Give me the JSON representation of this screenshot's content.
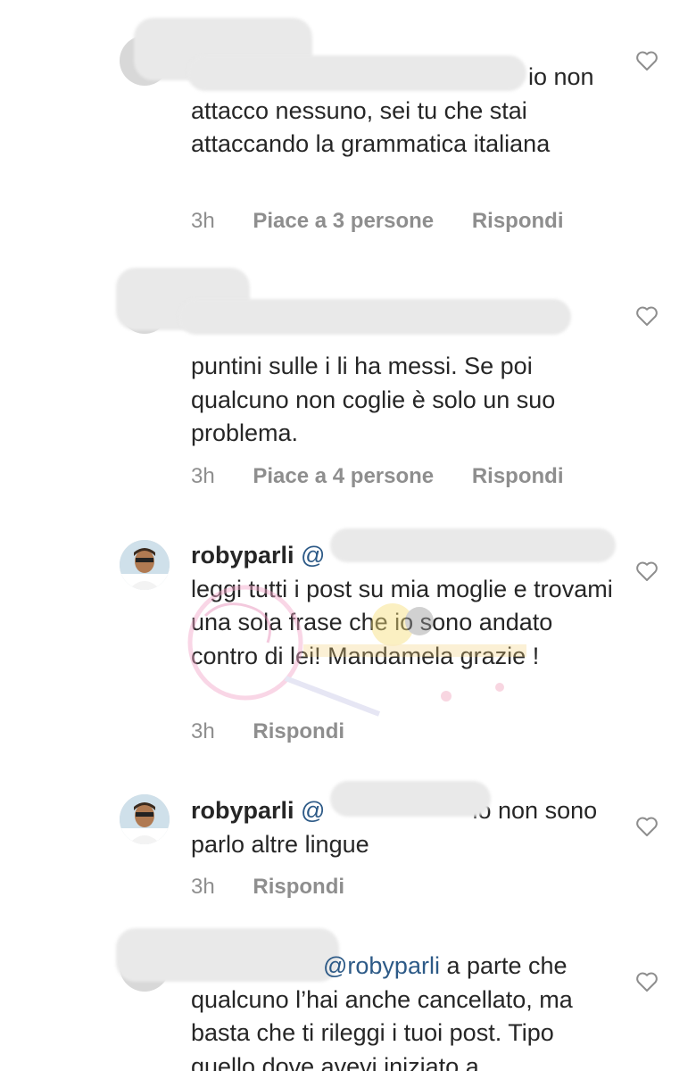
{
  "comments": [
    {
      "username": "",
      "mention": "",
      "text": "io non attacco nessuno, sei tu che stai attaccando la grammatica italiana",
      "time": "3h",
      "likes": "Piace a 3 persone",
      "reply": "Rispondi"
    },
    {
      "username": "",
      "mention": "",
      "text": "puntini sulle i li ha messi. Se poi qualcuno non coglie è solo un suo problema.",
      "time": "3h",
      "likes": "Piace a 4 persone",
      "reply": "Rispondi"
    },
    {
      "username": "robyparli",
      "mention": "@",
      "text": "leggi tutti i post su mia moglie e trovami una sola frase che io sono andato contro di lei! Mandamela grazie !",
      "time": "3h",
      "reply": "Rispondi"
    },
    {
      "username": "robyparli",
      "mention": "@",
      "text": "io non sono parlo altre lingue",
      "time": "3h",
      "reply": "Rispondi"
    },
    {
      "username": "",
      "mention": "@robyparli",
      "text": "a parte che qualcuno l’hai anche cancellato, ma basta che ti rileggi i tuoi post. Tipo quello dove avevi iniziato a",
      "time": "",
      "reply": ""
    }
  ],
  "icons": {
    "like": "heart-outline-icon"
  },
  "colors": {
    "text": "#262626",
    "meta": "#8e8e8e",
    "mention": "#2d5a87",
    "heart_stroke": "#8e8e8e"
  }
}
